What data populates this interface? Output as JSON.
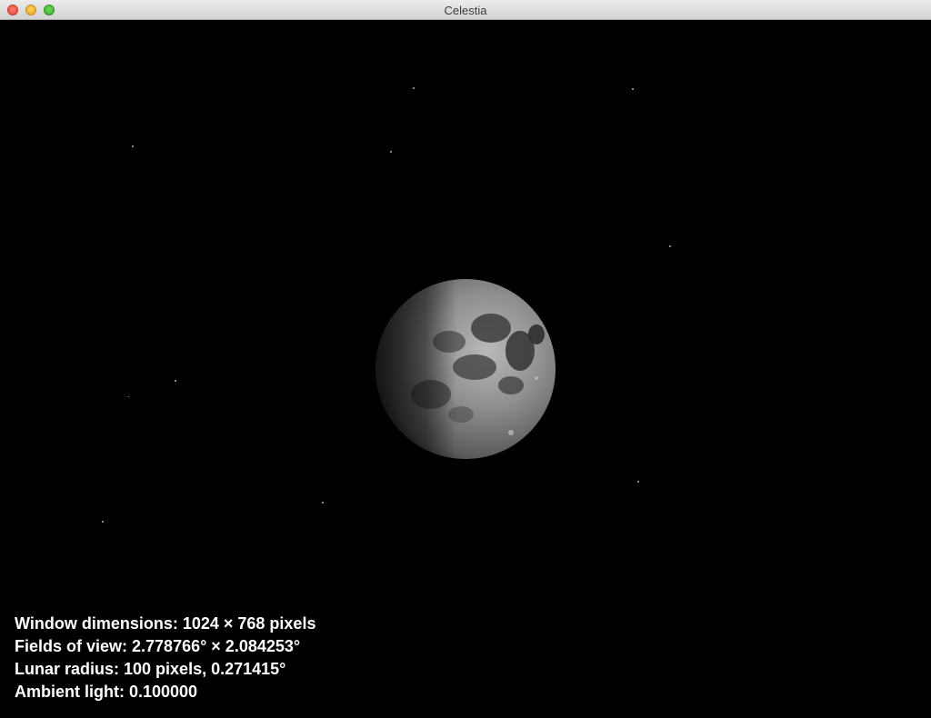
{
  "window": {
    "title": "Celestia"
  },
  "overlay": {
    "lines": [
      "Window dimensions: 1024 × 768 pixels",
      "Fields of view: 2.778766° × 2.084253°",
      "Lunar radius: 100 pixels, 0.271415°",
      "Ambient light: 0.100000"
    ]
  },
  "colors": {
    "background": "#000000",
    "overlay_text": "#ffffff",
    "star": "#b8b8b8"
  }
}
